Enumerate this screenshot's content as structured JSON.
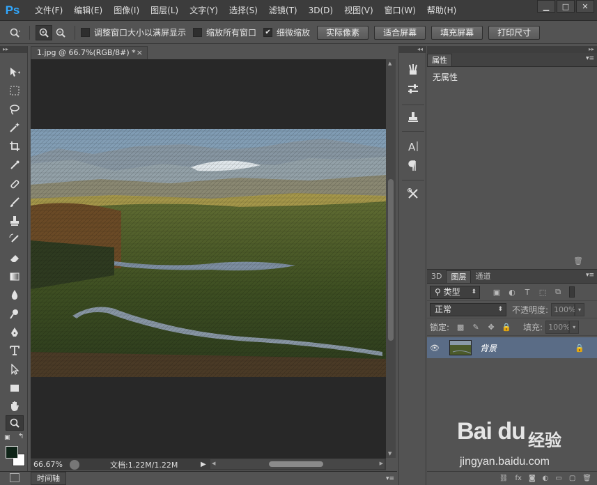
{
  "app": {
    "logo": "Ps"
  },
  "menu": [
    "文件(F)",
    "编辑(E)",
    "图像(I)",
    "图层(L)",
    "文字(Y)",
    "选择(S)",
    "滤镜(T)",
    "3D(D)",
    "视图(V)",
    "窗口(W)",
    "帮助(H)"
  ],
  "window_controls": {
    "minimize": "▁",
    "maximize": "□",
    "close": "✕"
  },
  "options": {
    "resize_windows": {
      "label": "调整窗口大小以满屏显示",
      "checked": false
    },
    "zoom_all": {
      "label": "缩放所有窗口",
      "checked": false
    },
    "scrubby_zoom": {
      "label": "细微缩放",
      "checked": true
    },
    "buttons": [
      "实际像素",
      "适合屏幕",
      "填充屏幕",
      "打印尺寸"
    ]
  },
  "document": {
    "tab_title": "1.jpg @ 66.7%(RGB/8#) *",
    "zoom": "66.67%",
    "doc_size": "文档:1.22M/1.22M"
  },
  "timeline": {
    "label": "时间轴"
  },
  "properties": {
    "tab": "属性",
    "message": "无属性"
  },
  "layers": {
    "tabs": [
      "3D",
      "图层",
      "通道"
    ],
    "active_tab": "图层",
    "filter_kind": "类型",
    "blend_mode": "正常",
    "opacity_label": "不透明度:",
    "opacity_value": "100%",
    "lock_label": "锁定:",
    "fill_label": "填充:",
    "fill_value": "100%",
    "items": [
      {
        "name": "背景",
        "visible": true,
        "locked": true
      }
    ]
  },
  "watermark": {
    "logo": "Bai du",
    "cn": "经验",
    "url": "jingyan.baidu.com"
  }
}
